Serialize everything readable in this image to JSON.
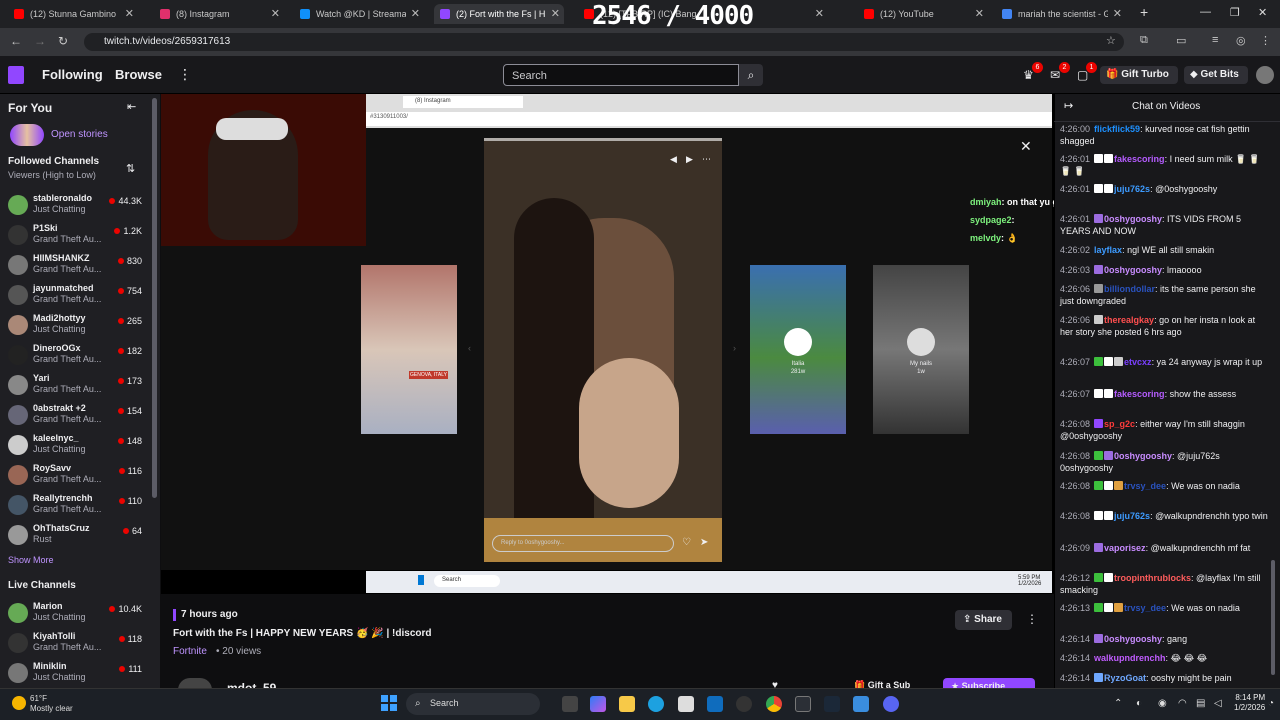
{
  "browser": {
    "tabs": [
      {
        "label": "(12) Stunna Gambino",
        "color": "#ff0000"
      },
      {
        "label": "(8) Instagram",
        "color": "#e1306c"
      },
      {
        "label": "Watch @KD | Streamable",
        "color": "#0f90fa"
      },
      {
        "label": "(2) Fort with the Fs | H",
        "color": "#9147ff"
      },
      {
        "label": "(12) [TFB:RP] (IC) Bang",
        "color": "#ff0000"
      },
      {
        "label": "(12) YouTube",
        "color": "#ff0000"
      },
      {
        "label": "mariah the scientist - Goo",
        "color": "#4285f4"
      }
    ],
    "overlay_counter": "2546 / 4000",
    "url": "twitch.tv/videos/2659317613"
  },
  "twitch": {
    "following": "Following",
    "browse": "Browse",
    "search_placeholder": "Search",
    "badges": {
      "inbox": "6",
      "notifications": "2",
      "whispers": "1"
    },
    "gift_turbo": "Gift Turbo",
    "get_bits": "Get Bits"
  },
  "sidebar": {
    "for_you": "For You",
    "open_stories": "Open stories",
    "followed_channels": "Followed Channels",
    "sort": "Viewers (High to Low)",
    "channels": [
      {
        "name": "stableronaldo",
        "game": "Just Chatting",
        "viewers": "44.3K"
      },
      {
        "name": "P1Ski",
        "game": "Grand Theft Au...",
        "viewers": "1.2K"
      },
      {
        "name": "HIIMSHANKZ",
        "game": "Grand Theft Au...",
        "viewers": "830"
      },
      {
        "name": "jayunmatched",
        "game": "Grand Theft Au...",
        "viewers": "754"
      },
      {
        "name": "Madi2hottyy",
        "game": "Just Chatting",
        "viewers": "265"
      },
      {
        "name": "DineroOGx",
        "game": "Grand Theft Au...",
        "viewers": "182"
      },
      {
        "name": "Yari",
        "game": "Grand Theft Au...",
        "viewers": "173"
      },
      {
        "name": "0abstrakt +2",
        "game": "Grand Theft Au...",
        "viewers": "154"
      },
      {
        "name": "kaleelnyc_",
        "game": "Just Chatting",
        "viewers": "148"
      },
      {
        "name": "RoySavv",
        "game": "Grand Theft Au...",
        "viewers": "116"
      },
      {
        "name": "Reallytrenchh",
        "game": "Grand Theft Au...",
        "viewers": "110"
      },
      {
        "name": "OhThatsCruz",
        "game": "Rust",
        "viewers": "64"
      }
    ],
    "show_more": "Show More",
    "live_channels": "Live Channels",
    "live": [
      {
        "name": "Marion",
        "game": "Just Chatting",
        "viewers": "10.4K"
      },
      {
        "name": "KiyahTolli",
        "game": "Grand Theft Au...",
        "viewers": "118"
      },
      {
        "name": "Miniklin",
        "game": "Just Chatting",
        "viewers": "111"
      }
    ]
  },
  "video": {
    "inner_tab": "(8) Instagram",
    "inner_url": "#3130911003/",
    "story_reply": "Reply to 0oshygooshy...",
    "thumb1_caption": "GENOVA, ITALY",
    "thumb2_caption": "Italia",
    "thumb2_sub": "281w",
    "thumb3_caption": "My nails",
    "thumb3_sub": "1w",
    "overlay_chat": [
      {
        "name": "dmiyah",
        "text": "on that yu getting matcha"
      },
      {
        "name": "sydpage2",
        "text": ""
      },
      {
        "name": "melvdy",
        "text": "👌"
      }
    ],
    "inner_search": "Search",
    "inner_clock": "5:59 PM",
    "inner_date": "1/2/2026"
  },
  "info": {
    "ago": "7 hours ago",
    "title": "Fort with the Fs | HAPPY NEW YEARS 🥳 🎉 | !discord",
    "game": "Fortnite",
    "views": "• 20 views",
    "share": "Share",
    "streamer": "mdot_59",
    "gift_sub": "Gift a Sub",
    "subscribe": "Subscribe"
  },
  "chat": {
    "title": "Chat on Videos",
    "messages": [
      {
        "ts": "4:26:00",
        "name": "flickflick59",
        "color": "#1e90ff",
        "text": ": kurved nose cat fish gettin shagged",
        "icons": []
      },
      {
        "ts": "4:26:01",
        "name": "fakescoring",
        "color": "#b55cff",
        "text": ": I need sum milk 🥛 🥛 🥛 🥛",
        "icons": [
          "#ffffff",
          "#ffffff"
        ]
      },
      {
        "ts": "4:26:01",
        "name": "juju762s",
        "color": "#3d9bff",
        "text": ": @0oshygooshy",
        "icons": [
          "#ffffff",
          "#ffffff"
        ]
      },
      {
        "ts": "4:26:01",
        "name": "0oshygooshy",
        "color": "#c88cff",
        "text": ": ITS VIDS FROM 5 YEARS AND NOW",
        "icons": [
          "#9c6ce0"
        ]
      },
      {
        "ts": "4:26:02",
        "name": "layflax",
        "color": "#3d9bff",
        "text": ": ngl WE all still smakin",
        "icons": []
      },
      {
        "ts": "4:26:03",
        "name": "0oshygooshy",
        "color": "#c88cff",
        "text": ": lmaoooo",
        "icons": [
          "#9c6ce0"
        ]
      },
      {
        "ts": "4:26:06",
        "name": "billiondollar",
        "color": "#2a52be",
        "text": ": its the same person she just downgraded",
        "icons": [
          "#999999"
        ]
      },
      {
        "ts": "4:26:06",
        "name": "therealgkay",
        "color": "#ff4f4f",
        "text": ": go on her insta n look at her story she posted 6 hrs ago",
        "icons": [
          "#cccccc"
        ]
      },
      {
        "ts": "4:26:07",
        "name": "etvcxz",
        "color": "#7a3fff",
        "text": ": ya 24 anyway js wrap it up",
        "icons": [
          "#3cbf3c",
          "#ffffff",
          "#cccccc"
        ]
      },
      {
        "ts": "4:26:07",
        "name": "fakescoring",
        "color": "#b55cff",
        "text": ": show the assess",
        "icons": [
          "#ffffff",
          "#ffffff"
        ]
      },
      {
        "ts": "4:26:08",
        "name": "sp_g2c",
        "color": "#ff3b3b",
        "text": ": either way I'm still shaggin @0oshygooshy",
        "icons": [
          "#9147ff"
        ]
      },
      {
        "ts": "4:26:08",
        "name": "0oshygooshy",
        "color": "#c88cff",
        "text": ": @juju762s 0oshygooshy",
        "icons": [
          "#3cbf3c",
          "#9c6ce0"
        ]
      },
      {
        "ts": "4:26:08",
        "name": "trvsy_dee",
        "color": "#2a52be",
        "text": ": We was on nadia",
        "icons": [
          "#3cbf3c",
          "#ffffff",
          "#e0a040"
        ]
      },
      {
        "ts": "4:26:08",
        "name": "juju762s",
        "color": "#3d9bff",
        "text": ": @walkupndrenchh typo twin",
        "icons": [
          "#ffffff",
          "#ffffff"
        ]
      },
      {
        "ts": "4:26:09",
        "name": "vaporisez",
        "color": "#c88cff",
        "text": ": @walkupndrenchh mf fat",
        "icons": [
          "#9c6ce0"
        ]
      },
      {
        "ts": "4:26:12",
        "name": "troopinthrublocks",
        "color": "#ff5c5c",
        "text": ": @layflax I'm still smacking",
        "icons": [
          "#3cbf3c",
          "#ffffff"
        ]
      },
      {
        "ts": "4:26:13",
        "name": "trvsy_dee",
        "color": "#2a52be",
        "text": ": We was on nadia",
        "icons": [
          "#3cbf3c",
          "#ffffff",
          "#e0a040"
        ]
      },
      {
        "ts": "4:26:14",
        "name": "0oshygooshy",
        "color": "#c88cff",
        "text": ": gang",
        "icons": [
          "#9c6ce0"
        ]
      },
      {
        "ts": "4:26:14",
        "name": "walkupndrenchh",
        "color": "#c05cff",
        "text": ": 😂 😂 😂",
        "icons": []
      },
      {
        "ts": "4:26:14",
        "name": "RyzoGoat",
        "color": "#6fa8ff",
        "text": ": ooshy might be pain",
        "icons": [
          "#6fa8ff"
        ]
      }
    ]
  },
  "taskbar": {
    "temp": "61°F",
    "weather": "Mostly clear",
    "search": "Search",
    "time": "8:14 PM",
    "date": "1/2/2026"
  }
}
